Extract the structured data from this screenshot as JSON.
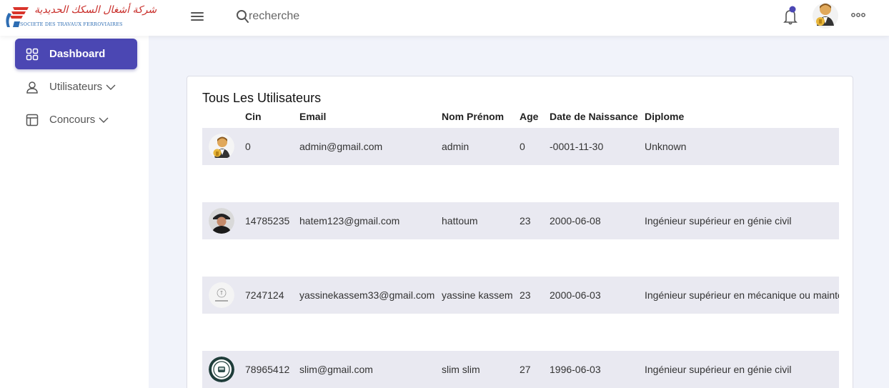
{
  "header": {
    "logo_ar": "شركة أشغال السكك الحديدية",
    "logo_fr": "SOCIETE DES TRAVAUX FERROVIAIRES",
    "search_placeholder": "recherche"
  },
  "sidebar": {
    "items": [
      {
        "label": "Dashboard",
        "icon": "grid-icon",
        "active": true
      },
      {
        "label": "Utilisateurs",
        "icon": "user-icon",
        "has_submenu": true
      },
      {
        "label": "Concours",
        "icon": "layout-icon",
        "has_submenu": true
      }
    ]
  },
  "table": {
    "title": "Tous Les Utilisateurs",
    "columns": [
      "Cin",
      "Email",
      "Nom Prénom",
      "Age",
      "Date de Naissance",
      "Diplome"
    ],
    "rows": [
      {
        "avatar": "admin-avatar",
        "cin": "0",
        "email": "admin@gmail.com",
        "nom": "admin",
        "age": "0",
        "date": "-0001-11-30",
        "diplome": "Unknown"
      },
      {
        "avatar": "user-photo-avatar",
        "cin": "14785235",
        "email": "hatem123@gmail.com",
        "nom": "hattoum",
        "age": "23",
        "date": "2000-06-08",
        "diplome": "Ingénieur supérieur en génie civil"
      },
      {
        "avatar": "logo-avatar",
        "cin": "7247124",
        "email": "yassinekassem33@gmail.com",
        "nom": "yassine kassem",
        "age": "23",
        "date": "2000-06-03",
        "diplome": "Ingénieur supérieur en mécanique ou maintenance"
      },
      {
        "avatar": "badge-avatar",
        "cin": "78965412",
        "email": "slim@gmail.com",
        "nom": "slim slim",
        "age": "27",
        "date": "1996-06-03",
        "diplome": "Ingénieur supérieur en génie civil"
      }
    ]
  },
  "colors": {
    "accent": "#4b47b3",
    "row_shade": "#e9e9f1",
    "page_bg": "#f1f3fa"
  }
}
